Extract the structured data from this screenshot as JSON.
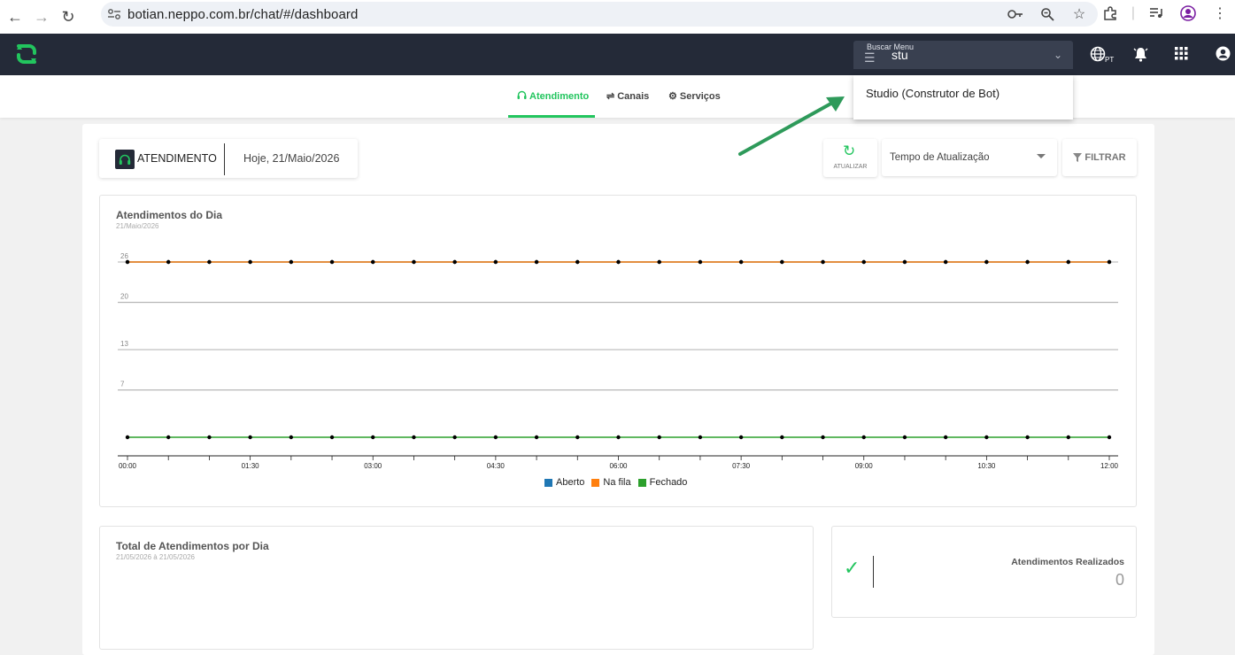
{
  "browser": {
    "url": "botian.neppo.com.br/chat/#/dashboard"
  },
  "header": {
    "menu_search_label": "Buscar Menu",
    "menu_search_value": "stu",
    "language_code": "PT"
  },
  "dropdown": {
    "items": [
      "Studio (Construtor de Bot)"
    ]
  },
  "tabs": [
    {
      "label": "Atendimento",
      "active": true
    },
    {
      "label": "Canais",
      "active": false
    },
    {
      "label": "Serviços",
      "active": false
    }
  ],
  "toolbar": {
    "section_label": "ATENDIMENTO",
    "date_label": "Hoje, 21/Maio/2026",
    "refresh_label": "ATUALIZAR",
    "refresh_select_placeholder": "Tempo de Atualização",
    "filter_label": "FILTRAR"
  },
  "chart_panel": {
    "title": "Atendimentos do Dia",
    "subtitle": "21/Maio/2026"
  },
  "chart_data": {
    "type": "line",
    "title": "Atendimentos do Dia",
    "subtitle": "21/Maio/2026",
    "x": [
      "00:00",
      "00:30",
      "01:00",
      "01:30",
      "02:00",
      "02:30",
      "03:00",
      "03:30",
      "04:00",
      "04:30",
      "05:00",
      "05:30",
      "06:00",
      "06:30",
      "07:00",
      "07:30",
      "08:00",
      "08:30",
      "09:00",
      "09:30",
      "10:00",
      "10:30",
      "11:00",
      "11:30",
      "12:00"
    ],
    "x_tick_labels": [
      "00:00",
      "01:30",
      "03:00",
      "04:30",
      "06:00",
      "07:30",
      "09:00",
      "10:30",
      "12:00"
    ],
    "y_tick_labels": [
      "26",
      "20",
      "13",
      "7"
    ],
    "y_ticks": [
      26,
      20,
      13,
      7
    ],
    "ylim": [
      0,
      26
    ],
    "grid": true,
    "legend_position": "bottom",
    "series": [
      {
        "name": "Aberto",
        "color": "#1f77b4",
        "values": [
          26,
          26,
          26,
          26,
          26,
          26,
          26,
          26,
          26,
          26,
          26,
          26,
          26,
          26,
          26,
          26,
          26,
          26,
          26,
          26,
          26,
          26,
          26,
          26,
          26
        ]
      },
      {
        "name": "Na fila",
        "color": "#ff7f0e",
        "values": [
          26,
          26,
          26,
          26,
          26,
          26,
          26,
          26,
          26,
          26,
          26,
          26,
          26,
          26,
          26,
          26,
          26,
          26,
          26,
          26,
          26,
          26,
          26,
          26,
          26
        ]
      },
      {
        "name": "Fechado",
        "color": "#2ca02c",
        "values": [
          0,
          0,
          0,
          0,
          0,
          0,
          0,
          0,
          0,
          0,
          0,
          0,
          0,
          0,
          0,
          0,
          0,
          0,
          0,
          0,
          0,
          0,
          0,
          0,
          0
        ]
      }
    ]
  },
  "total_panel": {
    "title": "Total de Atendimentos por Dia",
    "subtitle": "21/05/2026 à 21/05/2026"
  },
  "done_panel": {
    "label": "Atendimentos Realizados",
    "value": "0"
  },
  "colors": {
    "accent": "#22c55e",
    "header_bg": "#242a38"
  }
}
